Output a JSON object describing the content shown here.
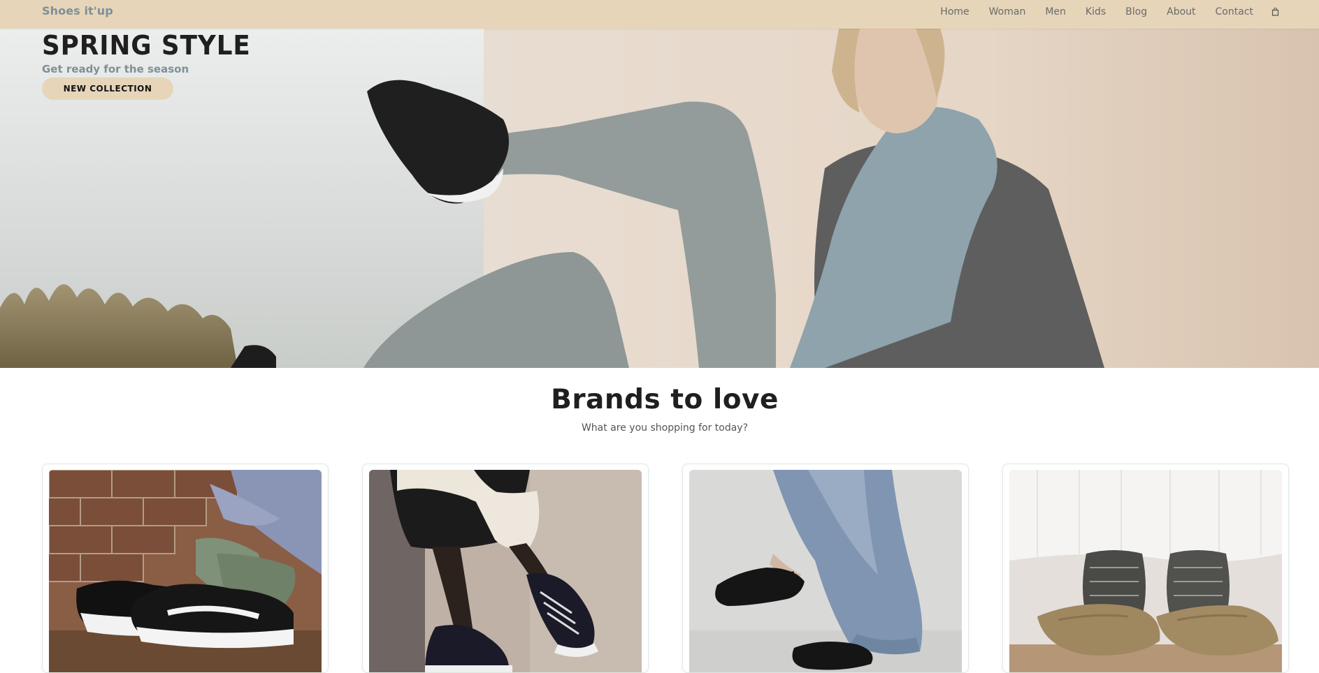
{
  "navbar": {
    "brand": "Shoes it'up",
    "links": [
      "Home",
      "Woman",
      "Men",
      "Kids",
      "Blog",
      "About",
      "Contact"
    ],
    "cart_icon": "shopping-bag-icon",
    "background_color": "#e6d5b9"
  },
  "hero": {
    "title": "SPRING STYLE",
    "subtitle": "Get ready for the season",
    "button_label": "NEW COLLECTION"
  },
  "brands": {
    "title": "Brands to love",
    "subtitle": "What are you shopping for today?",
    "cards": [
      {
        "image": "sneakers-photo"
      },
      {
        "image": "high-top-sneakers-photo"
      },
      {
        "image": "ballet-flats-photo"
      },
      {
        "image": "clogs-photo"
      }
    ]
  },
  "colors": {
    "accent": "#e6d5b9",
    "muted_text": "#7f8f99",
    "heading": "#1f1f1f"
  }
}
